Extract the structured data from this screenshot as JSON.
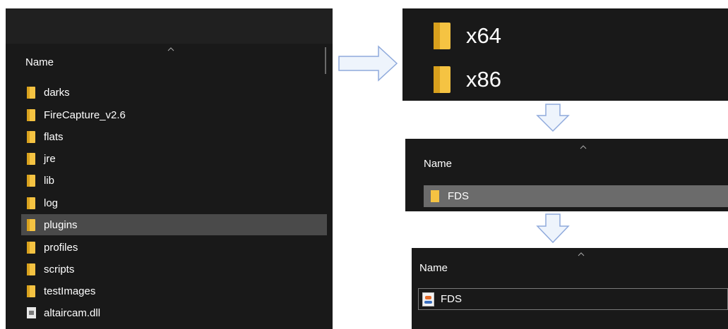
{
  "left_panel": {
    "column_header": "Name",
    "items": [
      {
        "label": "darks",
        "type": "folder"
      },
      {
        "label": "FireCapture_v2.6",
        "type": "folder"
      },
      {
        "label": "flats",
        "type": "folder"
      },
      {
        "label": "jre",
        "type": "folder"
      },
      {
        "label": "lib",
        "type": "folder"
      },
      {
        "label": "log",
        "type": "folder"
      },
      {
        "label": "plugins",
        "type": "folder",
        "selected": true
      },
      {
        "label": "profiles",
        "type": "folder"
      },
      {
        "label": "scripts",
        "type": "folder"
      },
      {
        "label": "testImages",
        "type": "folder"
      },
      {
        "label": "altaircam.dll",
        "type": "file"
      }
    ]
  },
  "arch_panel": {
    "items": [
      {
        "label": "x64"
      },
      {
        "label": "x86"
      }
    ]
  },
  "fds_folder_panel": {
    "column_header": "Name",
    "item": {
      "label": "FDS",
      "type": "folder",
      "selected": true
    }
  },
  "fds_file_panel": {
    "column_header": "Name",
    "item": {
      "label": "FDS",
      "type": "java-file"
    }
  },
  "colors": {
    "explorer_bg": "#191919",
    "folder": "#f5c342",
    "selection": "#4a4a4a",
    "arrow_fill": "#eef4fc",
    "arrow_stroke": "#8faadc"
  }
}
